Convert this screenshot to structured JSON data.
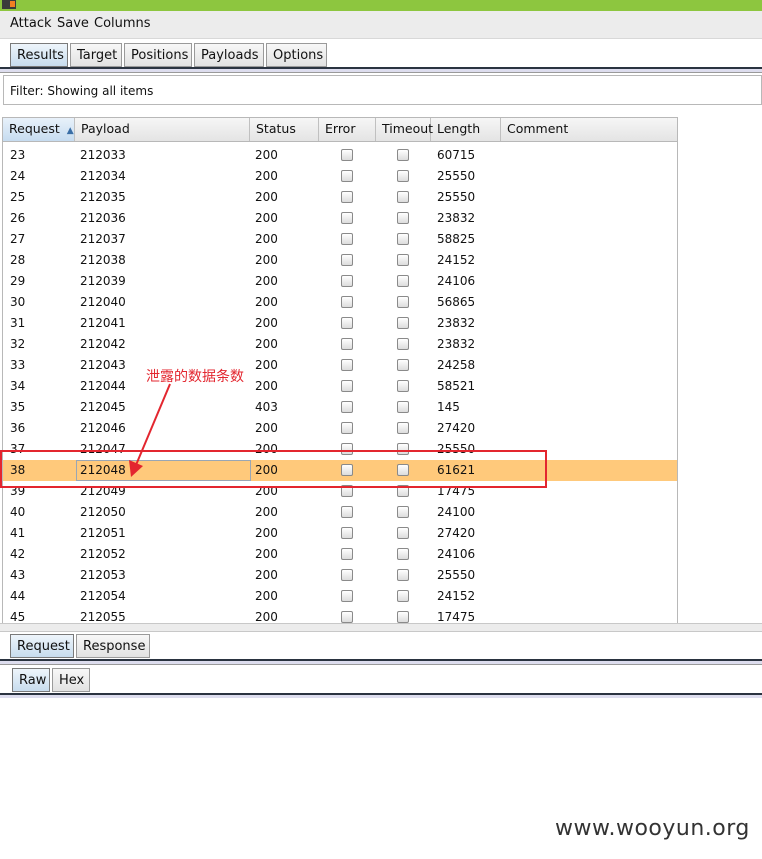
{
  "menu": [
    "Attack",
    "Save",
    "Columns"
  ],
  "main_tabs": [
    "Results",
    "Target",
    "Positions",
    "Payloads",
    "Options"
  ],
  "filter": "Filter: Showing all items",
  "columns": [
    "Request",
    "Payload",
    "Status",
    "Error",
    "Timeout",
    "Length",
    "Comment"
  ],
  "sort_indicator": "▲",
  "rows": [
    {
      "req": "23",
      "payload": "212033",
      "status": "200",
      "length": "60715"
    },
    {
      "req": "24",
      "payload": "212034",
      "status": "200",
      "length": "25550"
    },
    {
      "req": "25",
      "payload": "212035",
      "status": "200",
      "length": "25550"
    },
    {
      "req": "26",
      "payload": "212036",
      "status": "200",
      "length": "23832"
    },
    {
      "req": "27",
      "payload": "212037",
      "status": "200",
      "length": "58825"
    },
    {
      "req": "28",
      "payload": "212038",
      "status": "200",
      "length": "24152"
    },
    {
      "req": "29",
      "payload": "212039",
      "status": "200",
      "length": "24106"
    },
    {
      "req": "30",
      "payload": "212040",
      "status": "200",
      "length": "56865"
    },
    {
      "req": "31",
      "payload": "212041",
      "status": "200",
      "length": "23832"
    },
    {
      "req": "32",
      "payload": "212042",
      "status": "200",
      "length": "23832"
    },
    {
      "req": "33",
      "payload": "212043",
      "status": "200",
      "length": "24258"
    },
    {
      "req": "34",
      "payload": "212044",
      "status": "200",
      "length": "58521"
    },
    {
      "req": "35",
      "payload": "212045",
      "status": "403",
      "length": "145"
    },
    {
      "req": "36",
      "payload": "212046",
      "status": "200",
      "length": "27420"
    },
    {
      "req": "37",
      "payload": "212047",
      "status": "200",
      "length": "25550"
    },
    {
      "req": "38",
      "payload": "212048",
      "status": "200",
      "length": "61621"
    },
    {
      "req": "39",
      "payload": "212049",
      "status": "200",
      "length": "17475"
    },
    {
      "req": "40",
      "payload": "212050",
      "status": "200",
      "length": "24100"
    },
    {
      "req": "41",
      "payload": "212051",
      "status": "200",
      "length": "27420"
    },
    {
      "req": "42",
      "payload": "212052",
      "status": "200",
      "length": "24106"
    },
    {
      "req": "43",
      "payload": "212053",
      "status": "200",
      "length": "25550"
    },
    {
      "req": "44",
      "payload": "212054",
      "status": "200",
      "length": "24152"
    },
    {
      "req": "45",
      "payload": "212055",
      "status": "200",
      "length": "17475"
    }
  ],
  "selected_request": "38",
  "lower_tabs": [
    "Request",
    "Response"
  ],
  "view_tabs": [
    "Raw",
    "Hex"
  ],
  "annotation": "泄露的数据条数",
  "watermark": "www.wooyun.org",
  "colors": {
    "accent_green": "#8dc63f",
    "selected_row": "#ffc97b",
    "annotation_red": "#e3262f"
  }
}
